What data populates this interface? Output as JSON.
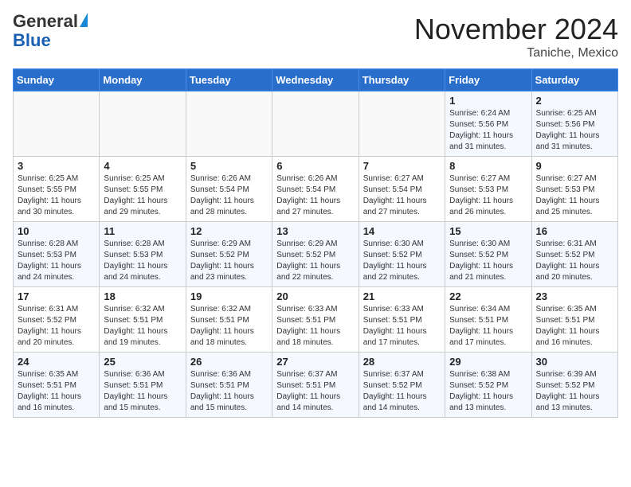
{
  "header": {
    "logo_general": "General",
    "logo_blue": "Blue",
    "title": "November 2024",
    "location": "Taniche, Mexico"
  },
  "days_of_week": [
    "Sunday",
    "Monday",
    "Tuesday",
    "Wednesday",
    "Thursday",
    "Friday",
    "Saturday"
  ],
  "weeks": [
    [
      {
        "day": "",
        "info": ""
      },
      {
        "day": "",
        "info": ""
      },
      {
        "day": "",
        "info": ""
      },
      {
        "day": "",
        "info": ""
      },
      {
        "day": "",
        "info": ""
      },
      {
        "day": "1",
        "info": "Sunrise: 6:24 AM\nSunset: 5:56 PM\nDaylight: 11 hours\nand 31 minutes."
      },
      {
        "day": "2",
        "info": "Sunrise: 6:25 AM\nSunset: 5:56 PM\nDaylight: 11 hours\nand 31 minutes."
      }
    ],
    [
      {
        "day": "3",
        "info": "Sunrise: 6:25 AM\nSunset: 5:55 PM\nDaylight: 11 hours\nand 30 minutes."
      },
      {
        "day": "4",
        "info": "Sunrise: 6:25 AM\nSunset: 5:55 PM\nDaylight: 11 hours\nand 29 minutes."
      },
      {
        "day": "5",
        "info": "Sunrise: 6:26 AM\nSunset: 5:54 PM\nDaylight: 11 hours\nand 28 minutes."
      },
      {
        "day": "6",
        "info": "Sunrise: 6:26 AM\nSunset: 5:54 PM\nDaylight: 11 hours\nand 27 minutes."
      },
      {
        "day": "7",
        "info": "Sunrise: 6:27 AM\nSunset: 5:54 PM\nDaylight: 11 hours\nand 27 minutes."
      },
      {
        "day": "8",
        "info": "Sunrise: 6:27 AM\nSunset: 5:53 PM\nDaylight: 11 hours\nand 26 minutes."
      },
      {
        "day": "9",
        "info": "Sunrise: 6:27 AM\nSunset: 5:53 PM\nDaylight: 11 hours\nand 25 minutes."
      }
    ],
    [
      {
        "day": "10",
        "info": "Sunrise: 6:28 AM\nSunset: 5:53 PM\nDaylight: 11 hours\nand 24 minutes."
      },
      {
        "day": "11",
        "info": "Sunrise: 6:28 AM\nSunset: 5:53 PM\nDaylight: 11 hours\nand 24 minutes."
      },
      {
        "day": "12",
        "info": "Sunrise: 6:29 AM\nSunset: 5:52 PM\nDaylight: 11 hours\nand 23 minutes."
      },
      {
        "day": "13",
        "info": "Sunrise: 6:29 AM\nSunset: 5:52 PM\nDaylight: 11 hours\nand 22 minutes."
      },
      {
        "day": "14",
        "info": "Sunrise: 6:30 AM\nSunset: 5:52 PM\nDaylight: 11 hours\nand 22 minutes."
      },
      {
        "day": "15",
        "info": "Sunrise: 6:30 AM\nSunset: 5:52 PM\nDaylight: 11 hours\nand 21 minutes."
      },
      {
        "day": "16",
        "info": "Sunrise: 6:31 AM\nSunset: 5:52 PM\nDaylight: 11 hours\nand 20 minutes."
      }
    ],
    [
      {
        "day": "17",
        "info": "Sunrise: 6:31 AM\nSunset: 5:52 PM\nDaylight: 11 hours\nand 20 minutes."
      },
      {
        "day": "18",
        "info": "Sunrise: 6:32 AM\nSunset: 5:51 PM\nDaylight: 11 hours\nand 19 minutes."
      },
      {
        "day": "19",
        "info": "Sunrise: 6:32 AM\nSunset: 5:51 PM\nDaylight: 11 hours\nand 18 minutes."
      },
      {
        "day": "20",
        "info": "Sunrise: 6:33 AM\nSunset: 5:51 PM\nDaylight: 11 hours\nand 18 minutes."
      },
      {
        "day": "21",
        "info": "Sunrise: 6:33 AM\nSunset: 5:51 PM\nDaylight: 11 hours\nand 17 minutes."
      },
      {
        "day": "22",
        "info": "Sunrise: 6:34 AM\nSunset: 5:51 PM\nDaylight: 11 hours\nand 17 minutes."
      },
      {
        "day": "23",
        "info": "Sunrise: 6:35 AM\nSunset: 5:51 PM\nDaylight: 11 hours\nand 16 minutes."
      }
    ],
    [
      {
        "day": "24",
        "info": "Sunrise: 6:35 AM\nSunset: 5:51 PM\nDaylight: 11 hours\nand 16 minutes."
      },
      {
        "day": "25",
        "info": "Sunrise: 6:36 AM\nSunset: 5:51 PM\nDaylight: 11 hours\nand 15 minutes."
      },
      {
        "day": "26",
        "info": "Sunrise: 6:36 AM\nSunset: 5:51 PM\nDaylight: 11 hours\nand 15 minutes."
      },
      {
        "day": "27",
        "info": "Sunrise: 6:37 AM\nSunset: 5:51 PM\nDaylight: 11 hours\nand 14 minutes."
      },
      {
        "day": "28",
        "info": "Sunrise: 6:37 AM\nSunset: 5:52 PM\nDaylight: 11 hours\nand 14 minutes."
      },
      {
        "day": "29",
        "info": "Sunrise: 6:38 AM\nSunset: 5:52 PM\nDaylight: 11 hours\nand 13 minutes."
      },
      {
        "day": "30",
        "info": "Sunrise: 6:39 AM\nSunset: 5:52 PM\nDaylight: 11 hours\nand 13 minutes."
      }
    ]
  ]
}
